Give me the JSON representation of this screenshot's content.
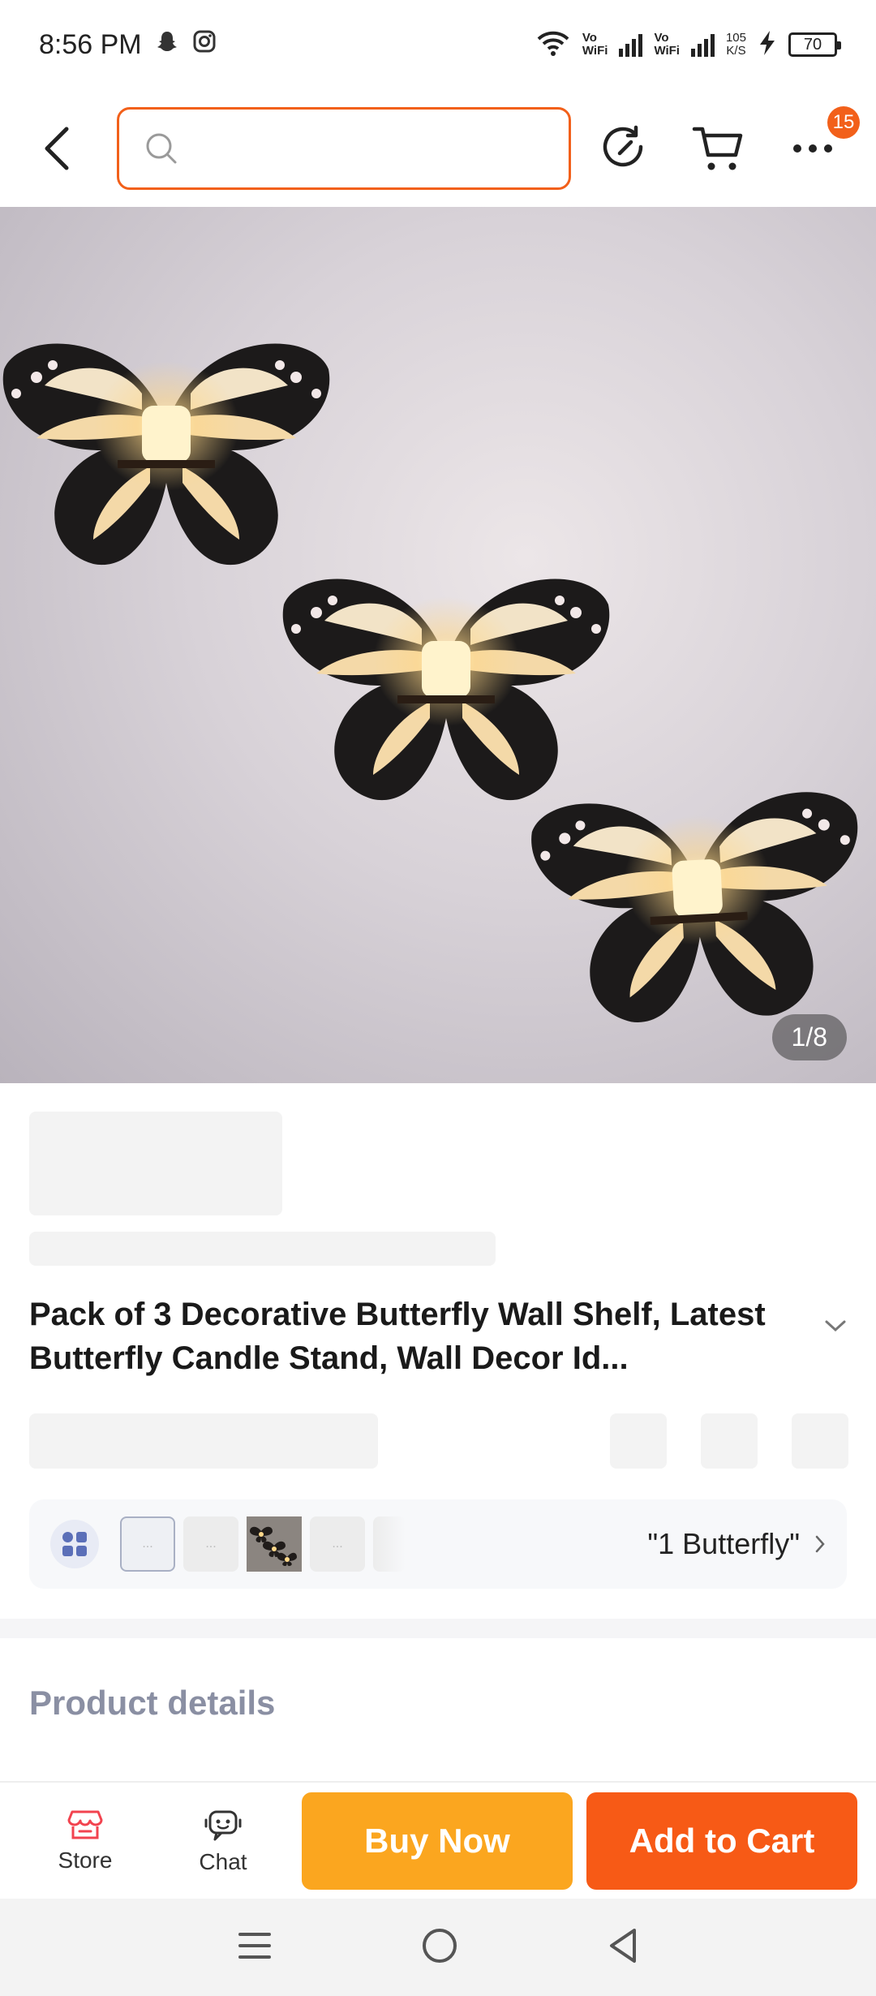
{
  "status_bar": {
    "time": "8:56 PM",
    "wifi_label_top": "Vo",
    "wifi_label_bottom": "WiFi",
    "sim2_label_top": "Vo",
    "sim2_label_bottom": "WiFi",
    "speed_value": "105",
    "speed_unit": "K/S",
    "battery": "70"
  },
  "top_bar": {
    "search_placeholder": "",
    "more_badge": "15"
  },
  "product_image": {
    "counter": "1/8"
  },
  "product": {
    "title": "Pack of 3 Decorative Butterfly Wall Shelf, Latest Butterfly Candle Stand, Wall Decor Id..."
  },
  "variant": {
    "selected_text": "\"1 Butterfly\"",
    "thumb_placeholder": "..."
  },
  "sections": {
    "product_details_title": "Product details"
  },
  "bottom_bar": {
    "store_label": "Store",
    "chat_label": "Chat",
    "buy_now_label": "Buy Now",
    "add_to_cart_label": "Add to Cart"
  },
  "colors": {
    "accent": "#f2601a",
    "buy_now": "#fba61f",
    "add_to_cart": "#f75a16"
  }
}
